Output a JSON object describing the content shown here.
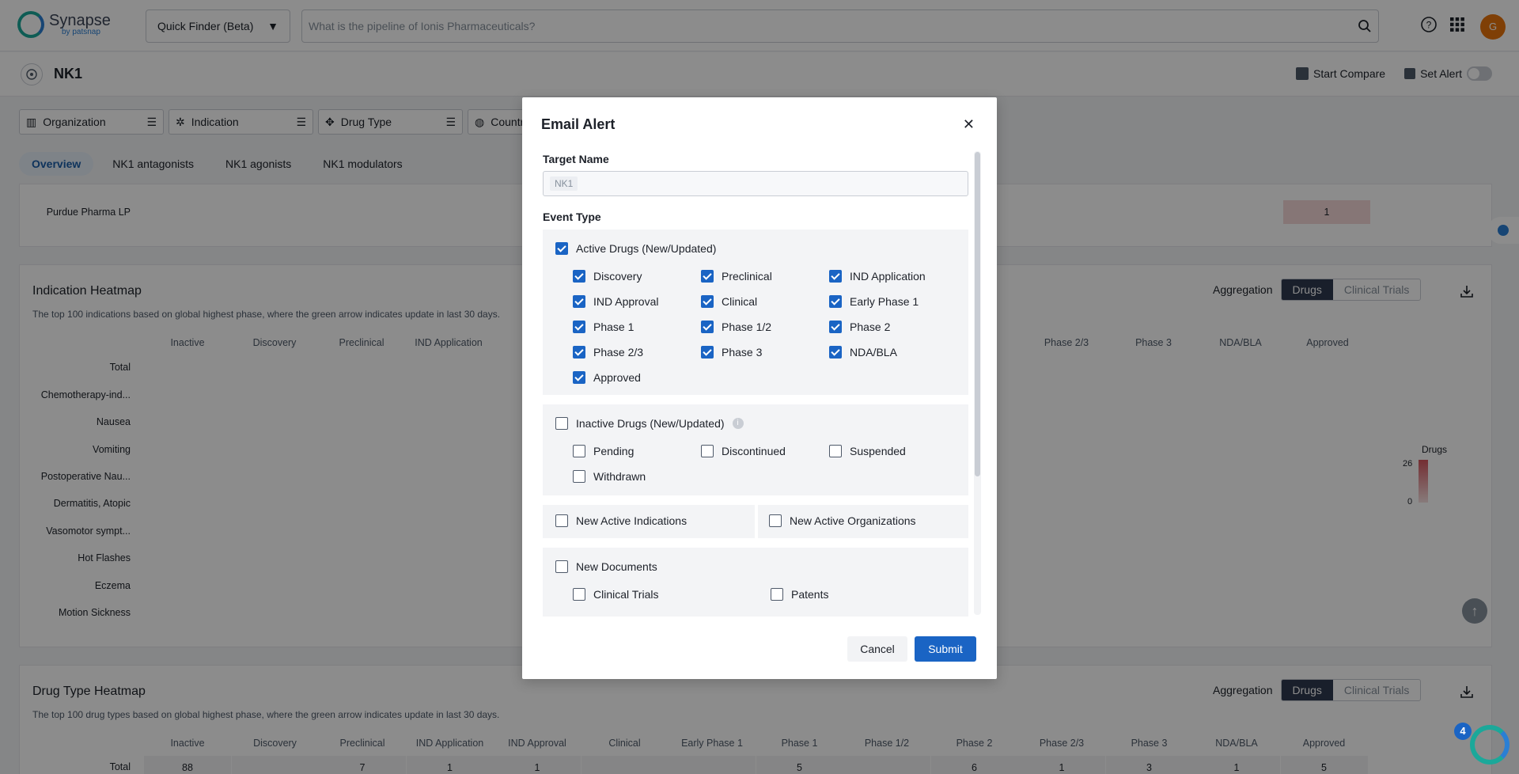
{
  "app": {
    "logo_title": "Synapse",
    "logo_sub": "by patsnap",
    "avatar_initial": "G"
  },
  "finder": {
    "label": "Quick Finder (Beta)"
  },
  "search": {
    "placeholder": "What is the pipeline of Ionis Pharmaceuticals?"
  },
  "target": {
    "name": "NK1",
    "start_compare": "Start Compare",
    "set_alert": "Set Alert"
  },
  "filters": [
    "Organization",
    "Indication",
    "Drug Type",
    "Country"
  ],
  "tabs": [
    "Overview",
    "NK1 antagonists",
    "NK1 agonists",
    "NK1 modulators"
  ],
  "org_rows": {
    "row1": "Purdue Pharma LP",
    "row1_value": "1"
  },
  "indication_heatmap": {
    "title": "Indication Heatmap",
    "desc": "The top 100 indications based on global highest phase, where the green arrow indicates update in last 30 days.",
    "aggregation_label": "Aggregation",
    "seg_on": "Drugs",
    "seg_off": "Clinical Trials",
    "columns_left": [
      "Inactive",
      "Discovery",
      "Preclinical",
      "IND Application"
    ],
    "columns_right": [
      "Phase 2/3",
      "Phase 3",
      "NDA/BLA",
      "Approved"
    ],
    "rows": [
      "Total",
      "Chemotherapy-ind...",
      "Nausea",
      "Vomiting",
      "Postoperative Nau...",
      "Dermatitis, Atopic",
      "Vasomotor sympt...",
      "Hot Flashes",
      "Eczema",
      "Motion Sickness"
    ],
    "legend_title": "Drugs",
    "legend_max": "26",
    "legend_min": "0"
  },
  "drugtype_heatmap": {
    "title": "Drug Type Heatmap",
    "desc": "The top 100 drug types based on global highest phase, where the green arrow indicates update in last 30 days.",
    "aggregation_label": "Aggregation",
    "seg_on": "Drugs",
    "seg_off": "Clinical Trials",
    "columns": [
      "Inactive",
      "Discovery",
      "Preclinical",
      "IND Application",
      "IND Approval",
      "Clinical",
      "Early Phase 1",
      "Phase 1",
      "Phase 1/2",
      "Phase 2",
      "Phase 2/3",
      "Phase 3",
      "NDA/BLA",
      "Approved"
    ],
    "total_label": "Total",
    "total_values": [
      "88",
      "",
      "7",
      "1",
      "1",
      "",
      "",
      "5",
      "",
      "6",
      "1",
      "3",
      "1",
      "5"
    ]
  },
  "modal": {
    "title": "Email Alert",
    "target_name_label": "Target Name",
    "target_tag": "NK1",
    "event_type_label": "Event Type",
    "active_drugs": {
      "label": "Active Drugs (New/Updated)",
      "items": [
        "Discovery",
        "Preclinical",
        "IND Application",
        "IND Approval",
        "Clinical",
        "Early Phase 1",
        "Phase 1",
        "Phase 1/2",
        "Phase 2",
        "Phase 2/3",
        "Phase 3",
        "NDA/BLA",
        "Approved"
      ]
    },
    "inactive_drugs": {
      "label": "Inactive Drugs (New/Updated)",
      "items": [
        "Pending",
        "Discontinued",
        "Suspended",
        "Withdrawn"
      ]
    },
    "new_active_indications": "New Active Indications",
    "new_active_organizations": "New Active Organizations",
    "new_documents": {
      "label": "New Documents",
      "items": [
        "Clinical Trials",
        "Patents"
      ]
    },
    "cancel": "Cancel",
    "submit": "Submit"
  },
  "float_badge": "4"
}
